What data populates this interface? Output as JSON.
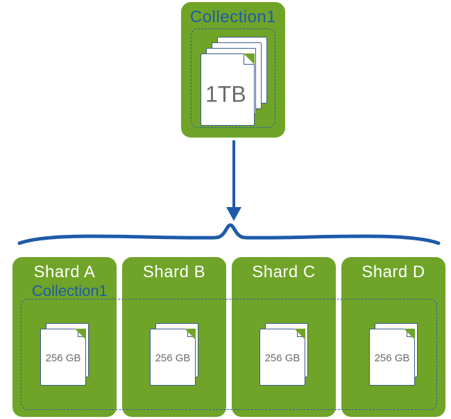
{
  "top": {
    "title": "Collection1",
    "size": "1TB"
  },
  "spanTitle": "Collection1",
  "shards": [
    {
      "title": "Shard A",
      "size": "256 GB"
    },
    {
      "title": "Shard B",
      "size": "256 GB"
    },
    {
      "title": "Shard C",
      "size": "256 GB"
    },
    {
      "title": "Shard D",
      "size": "256 GB"
    }
  ],
  "chart_data": {
    "type": "table",
    "title": "Collection1 sharding",
    "total": {
      "name": "Collection1",
      "size_tb": 1
    },
    "shards": [
      {
        "name": "Shard A",
        "size_gb": 256
      },
      {
        "name": "Shard B",
        "size_gb": 256
      },
      {
        "name": "Shard C",
        "size_gb": 256
      },
      {
        "name": "Shard D",
        "size_gb": 256
      }
    ]
  }
}
